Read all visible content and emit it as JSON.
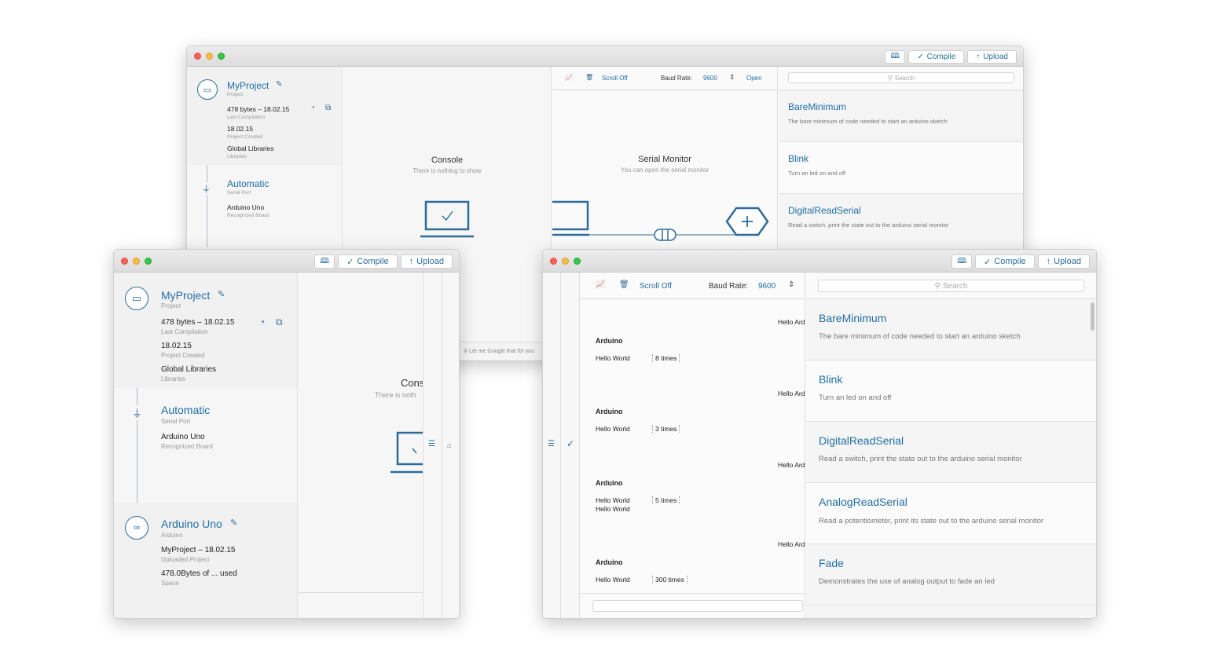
{
  "toolbar": {
    "compile": "Compile",
    "upload": "Upload"
  },
  "project": {
    "title": "MyProject",
    "type": "Project",
    "size": "478 bytes – 18.02.15",
    "size_label": "Last Compilation",
    "created": "18.02.15",
    "created_label": "Project Created",
    "libs": "Global Libraries",
    "libs_label": "Libraries"
  },
  "port": {
    "title": "Automatic",
    "type": "Serial Port",
    "board": "Arduino Uno",
    "board_label": "Recognized Board"
  },
  "board": {
    "title": "Arduino Uno",
    "type": "Arduino",
    "uploaded": "MyProject – 18.02.15",
    "uploaded_label": "Uploaded Project",
    "space": "478.0Bytes of ... used",
    "space_label": "Space"
  },
  "console": {
    "title": "Console",
    "subtitle": "There is nothing to show",
    "cropped_title": "Cons",
    "cropped_subtitle": "There is noth"
  },
  "serial": {
    "scroll": "Scroll Off",
    "baud_label": "Baud Rate:",
    "baud": "9600",
    "open": "Open",
    "title": "Serial Monitor",
    "subtitle": "You can open the serial monitor",
    "google": "Let me Google that for you"
  },
  "search": {
    "placeholder": "Search"
  },
  "libraries": [
    {
      "title": "BareMinimum",
      "desc": "The bare minimum of code needed to start an arduino sketch"
    },
    {
      "title": "Blink",
      "desc": "Turn an led on and off"
    },
    {
      "title": "DigitalReadSerial",
      "desc": "Read a switch, print the state out to the arduino serial monitor"
    },
    {
      "title": "AnalogReadSerial",
      "desc": "Read a potentiometer, print its state out to the arduino serial monitor"
    },
    {
      "title": "Fade",
      "desc": "Demonstrates the use of analog output to fade an led"
    }
  ],
  "log": [
    {
      "hello_right": "Hello Ard",
      "source": "Arduino",
      "msg": "Hello World",
      "msg2": "",
      "count": "8 times"
    },
    {
      "hello_right": "Hello Ard",
      "source": "Arduino",
      "msg": "Hello World",
      "msg2": "",
      "count": "3 times"
    },
    {
      "hello_right": "Hello Ard",
      "source": "Arduino",
      "msg": "Hello World",
      "msg2": "Hello World",
      "count": "5 times"
    },
    {
      "hello_right": "Hello Ard",
      "source": "Arduino",
      "msg": "Hello World",
      "msg2": "",
      "count": "300 times"
    }
  ],
  "colors": {
    "accent": "#1f6ea3",
    "red": "#fc605b",
    "yellow": "#fdbc40",
    "green": "#34c84a"
  }
}
